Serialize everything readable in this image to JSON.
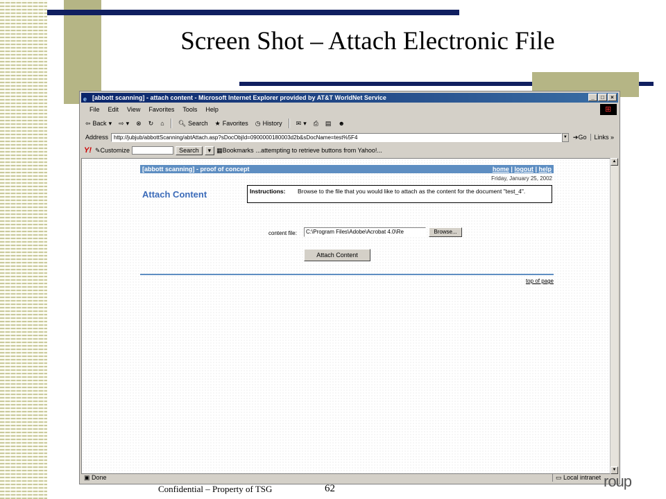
{
  "slide": {
    "title": "Screen Shot – Attach Electronic File",
    "footer": "Confidential – Property of TSG",
    "page_number": "62",
    "logo_partial": "roup"
  },
  "browser": {
    "title": "[abbott scanning] - attach content - Microsoft Internet Explorer provided by AT&T WorldNet Service",
    "window_buttons": [
      "_",
      "□",
      "×"
    ],
    "menu": [
      "File",
      "Edit",
      "View",
      "Favorites",
      "Tools",
      "Help"
    ],
    "toolbar": {
      "back": "Back",
      "search": "Search",
      "favorites": "Favorites",
      "history": "History"
    },
    "address": {
      "label": "Address",
      "url": "http://jubjub/abbottScanning/abtAttach.asp?sDocObjId=0900000180003d2b&sDocName=test%5F4",
      "go": "Go",
      "links": "Links"
    },
    "yahoo": {
      "logo": "Y!",
      "customize": "Customize",
      "search_button": "Search",
      "bookmarks": "Bookmarks",
      "status": "...attempting to retrieve buttons from Yahoo!..."
    },
    "status": {
      "left": "Done",
      "zone": "Local intranet"
    }
  },
  "webpage": {
    "site_title": "[abbott scanning] - proof of concept",
    "nav": [
      "home",
      "logout",
      "help"
    ],
    "nav_sep": "|",
    "date": "Friday, January 25, 2002",
    "heading": "Attach Content",
    "instructions_label": "Instructions:",
    "instructions_text": "Browse to the file that you would like to attach as the content for the document \"test_4\".",
    "file_label": "content file:",
    "file_value": "C:\\Program Files\\Adobe\\Acrobat 4.0\\Re",
    "browse_button": "Browse...",
    "attach_button": "Attach Content",
    "top_link": "top of page"
  },
  "colors": {
    "navy": "#101f60",
    "olive": "#b5b585",
    "page_header_blue": "#5e8ec2",
    "heading_blue": "#3a6ab8"
  }
}
